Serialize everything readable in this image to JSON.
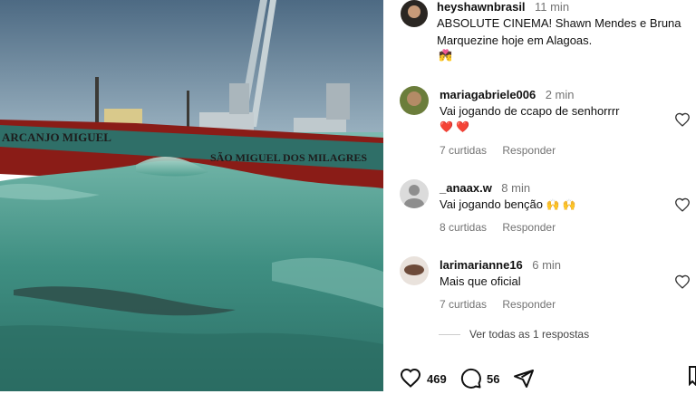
{
  "post": {
    "author": "heyshawnbrasil",
    "time": "11 min",
    "caption": "ABSOLUTE CINEMA! Shawn Mendes e Bruna Marquezine hoje em Alagoas.",
    "caption_emoji": "💏",
    "media": {
      "boat_text_left": "ARCANJO MIGUEL",
      "boat_text_right": "SÃO MIGUEL DOS MILAGRES"
    }
  },
  "comments": [
    {
      "user": "mariagabriele006",
      "time": "2 min",
      "text": "Vai jogando de ccapo de senhorrrr",
      "emoji": "❤️ ❤️",
      "likes": "7 curtidas",
      "reply": "Responder"
    },
    {
      "user": "_anaax.w",
      "time": "8 min",
      "text": "Vai jogando benção",
      "emoji": "🙌 🙌",
      "likes": "8 curtidas",
      "reply": "Responder"
    },
    {
      "user": "larimarianne16",
      "time": "6 min",
      "text": "Mais que oficial",
      "emoji": "",
      "likes": "7 curtidas",
      "reply": "Responder"
    }
  ],
  "view_all": "Ver todas as 1 respostas",
  "actions": {
    "likes_count": "469",
    "comments_count": "56"
  },
  "colors": {
    "heart_red": "#e0245e",
    "muted_text": "#737373",
    "sea": "#4f9e8f",
    "boat_red": "#8a1c17"
  }
}
